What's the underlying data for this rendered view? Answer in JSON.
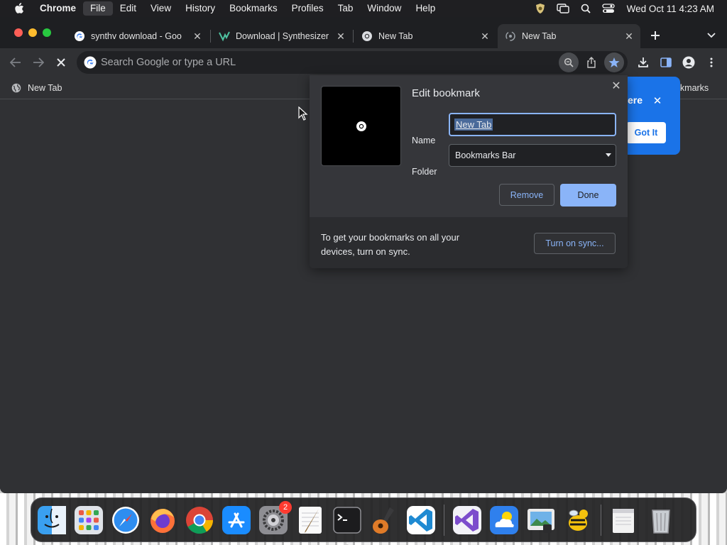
{
  "menubar": {
    "app_name": "Chrome",
    "items": [
      "File",
      "Edit",
      "View",
      "History",
      "Bookmarks",
      "Profiles",
      "Tab",
      "Window",
      "Help"
    ],
    "active_item": "File",
    "clock": "Wed Oct 11  4:23 AM",
    "status_icons": [
      "shield-bug-icon",
      "screen-mirror-icon",
      "spotlight-search-icon",
      "control-center-icon"
    ]
  },
  "tabs": [
    {
      "title": "synthv download - Goo",
      "favicon": "google-icon"
    },
    {
      "title": "Download | Synthesizer",
      "favicon": "synthv-icon"
    },
    {
      "title": "New Tab",
      "favicon": "chrome-icon"
    },
    {
      "title": "New Tab",
      "favicon": "chrome-icon",
      "active": true
    }
  ],
  "toolbar": {
    "omnibox_placeholder": "Search Google or type a URL",
    "icons": [
      "back-arrow-icon",
      "forward-arrow-icon",
      "stop-loading-icon",
      "zoom-icon",
      "share-icon",
      "star-bookmark-icon",
      "download-icon",
      "side-panel-icon",
      "profile-icon",
      "more-menu-icon"
    ]
  },
  "bookmarks_bar": {
    "items": [
      {
        "label": "New Tab",
        "favicon": "globe-icon"
      }
    ],
    "other_bookmarks_label": "ookmarks"
  },
  "iph_bubble": {
    "text": "ere",
    "button_label": "Got It"
  },
  "edit_bookmark": {
    "title": "Edit bookmark",
    "name_label": "Name",
    "name_value": "New Tab",
    "folder_label": "Folder",
    "folder_value": "Bookmarks Bar",
    "remove_label": "Remove",
    "done_label": "Done",
    "sync_text": "To get your bookmarks on all your devices, turn on sync.",
    "sync_button": "Turn on sync..."
  },
  "dock": {
    "apps": [
      "finder",
      "launchpad",
      "safari",
      "firefox",
      "chrome",
      "app-store",
      "system-settings",
      "textedit",
      "terminal",
      "garageband",
      "vscode"
    ],
    "apps_recent": [
      "visual-studio",
      "weather",
      "preview",
      "cyberduck"
    ],
    "others": [
      "downloads-stack",
      "trash"
    ],
    "system_settings_badge": "2",
    "colors": {
      "accent": "#8ab4f8",
      "iph": "#1a73e8",
      "window_bg": "#303134",
      "tabstrip_bg": "#1e1f22"
    }
  }
}
